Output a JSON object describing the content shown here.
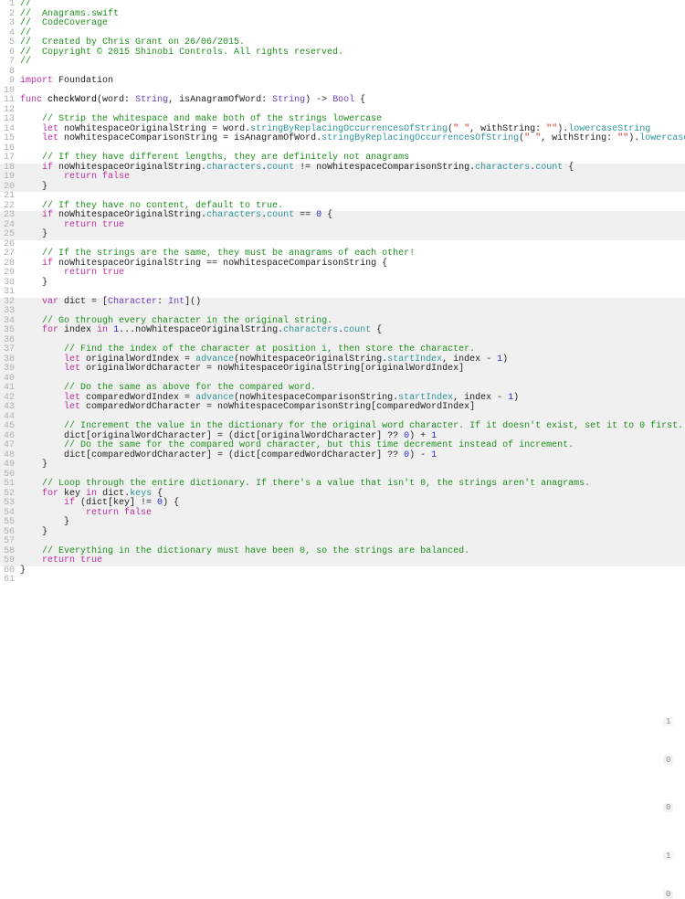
{
  "markers": [
    {
      "line": 14,
      "text": "1"
    },
    {
      "line": 18,
      "text": "0"
    },
    {
      "line": 23,
      "text": "0"
    },
    {
      "line": 28,
      "text": "1"
    },
    {
      "line": 32,
      "text": "0"
    }
  ],
  "lines": [
    {
      "n": 1,
      "hl": false,
      "spans": [
        [
          "comment",
          "//"
        ]
      ]
    },
    {
      "n": 2,
      "hl": false,
      "spans": [
        [
          "comment",
          "//  Anagrams.swift"
        ]
      ]
    },
    {
      "n": 3,
      "hl": false,
      "spans": [
        [
          "comment",
          "//  CodeCoverage"
        ]
      ]
    },
    {
      "n": 4,
      "hl": false,
      "spans": [
        [
          "comment",
          "//"
        ]
      ]
    },
    {
      "n": 5,
      "hl": false,
      "spans": [
        [
          "comment",
          "//  Created by Chris Grant on 26/06/2015."
        ]
      ]
    },
    {
      "n": 6,
      "hl": false,
      "spans": [
        [
          "comment",
          "//  Copyright © 2015 Shinobi Controls. All rights reserved."
        ]
      ]
    },
    {
      "n": 7,
      "hl": false,
      "spans": [
        [
          "comment",
          "//"
        ]
      ]
    },
    {
      "n": 8,
      "hl": false,
      "spans": [
        [
          "plain",
          ""
        ]
      ]
    },
    {
      "n": 9,
      "hl": false,
      "spans": [
        [
          "keyword",
          "import"
        ],
        [
          "plain",
          " Foundation"
        ]
      ]
    },
    {
      "n": 10,
      "hl": false,
      "spans": [
        [
          "plain",
          ""
        ]
      ]
    },
    {
      "n": 11,
      "hl": false,
      "spans": [
        [
          "keyword",
          "func"
        ],
        [
          "plain",
          " "
        ],
        [
          "black",
          "checkWord"
        ],
        [
          "plain",
          "(word: "
        ],
        [
          "type",
          "String"
        ],
        [
          "plain",
          ", isAnagramOfWord: "
        ],
        [
          "type",
          "String"
        ],
        [
          "plain",
          ") -> "
        ],
        [
          "type",
          "Bool"
        ],
        [
          "plain",
          " {"
        ]
      ]
    },
    {
      "n": 12,
      "hl": false,
      "spans": [
        [
          "plain",
          ""
        ]
      ]
    },
    {
      "n": 13,
      "hl": false,
      "spans": [
        [
          "plain",
          "    "
        ],
        [
          "comment",
          "// Strip the whitespace and make both of the strings lowercase"
        ]
      ]
    },
    {
      "n": 14,
      "hl": false,
      "spans": [
        [
          "plain",
          "    "
        ],
        [
          "keyword",
          "let"
        ],
        [
          "plain",
          " noWhitespaceOriginalString = word."
        ],
        [
          "func",
          "stringByReplacingOccurrencesOfString"
        ],
        [
          "plain",
          "("
        ],
        [
          "str",
          "\" \""
        ],
        [
          "plain",
          ", withString: "
        ],
        [
          "str",
          "\"\""
        ],
        [
          "plain",
          ")."
        ],
        [
          "ident",
          "lowercaseString"
        ]
      ]
    },
    {
      "n": 15,
      "hl": false,
      "spans": [
        [
          "plain",
          "    "
        ],
        [
          "keyword",
          "let"
        ],
        [
          "plain",
          " noWhitespaceComparisonString = isAnagramOfWord."
        ],
        [
          "func",
          "stringByReplacingOccurrencesOfString"
        ],
        [
          "plain",
          "("
        ],
        [
          "str",
          "\" \""
        ],
        [
          "plain",
          ", withString: "
        ],
        [
          "str",
          "\"\""
        ],
        [
          "plain",
          ")."
        ],
        [
          "ident",
          "lowercaseString"
        ]
      ]
    },
    {
      "n": 16,
      "hl": false,
      "spans": [
        [
          "plain",
          ""
        ]
      ]
    },
    {
      "n": 17,
      "hl": false,
      "spans": [
        [
          "plain",
          "    "
        ],
        [
          "comment",
          "// If they have different lengths, they are definitely not anagrams"
        ]
      ]
    },
    {
      "n": 18,
      "hl": true,
      "spans": [
        [
          "plain",
          "    "
        ],
        [
          "keyword",
          "if"
        ],
        [
          "plain",
          " noWhitespaceOriginalString."
        ],
        [
          "ident",
          "characters"
        ],
        [
          "plain",
          "."
        ],
        [
          "ident",
          "count"
        ],
        [
          "plain",
          " != noWhitespaceComparisonString."
        ],
        [
          "ident",
          "characters"
        ],
        [
          "plain",
          "."
        ],
        [
          "ident",
          "count"
        ],
        [
          "plain",
          " {"
        ]
      ]
    },
    {
      "n": 19,
      "hl": true,
      "spans": [
        [
          "plain",
          "        "
        ],
        [
          "keyword",
          "return"
        ],
        [
          "plain",
          " "
        ],
        [
          "keyword",
          "false"
        ]
      ]
    },
    {
      "n": 20,
      "hl": true,
      "spans": [
        [
          "plain",
          "    }"
        ]
      ]
    },
    {
      "n": 21,
      "hl": false,
      "spans": [
        [
          "plain",
          ""
        ]
      ]
    },
    {
      "n": 22,
      "hl": false,
      "spans": [
        [
          "plain",
          "    "
        ],
        [
          "comment",
          "// If they have no content, default to true."
        ]
      ]
    },
    {
      "n": 23,
      "hl": true,
      "spans": [
        [
          "plain",
          "    "
        ],
        [
          "keyword",
          "if"
        ],
        [
          "plain",
          " noWhitespaceOriginalString."
        ],
        [
          "ident",
          "characters"
        ],
        [
          "plain",
          "."
        ],
        [
          "ident",
          "count"
        ],
        [
          "plain",
          " == "
        ],
        [
          "num",
          "0"
        ],
        [
          "plain",
          " {"
        ]
      ]
    },
    {
      "n": 24,
      "hl": true,
      "spans": [
        [
          "plain",
          "        "
        ],
        [
          "keyword",
          "return"
        ],
        [
          "plain",
          " "
        ],
        [
          "keyword",
          "true"
        ]
      ]
    },
    {
      "n": 25,
      "hl": true,
      "spans": [
        [
          "plain",
          "    }"
        ]
      ]
    },
    {
      "n": 26,
      "hl": false,
      "spans": [
        [
          "plain",
          ""
        ]
      ]
    },
    {
      "n": 27,
      "hl": false,
      "spans": [
        [
          "plain",
          "    "
        ],
        [
          "comment",
          "// If the strings are the same, they must be anagrams of each other!"
        ]
      ]
    },
    {
      "n": 28,
      "hl": false,
      "spans": [
        [
          "plain",
          "    "
        ],
        [
          "keyword",
          "if"
        ],
        [
          "plain",
          " noWhitespaceOriginalString == noWhitespaceComparisonString {"
        ]
      ]
    },
    {
      "n": 29,
      "hl": false,
      "spans": [
        [
          "plain",
          "        "
        ],
        [
          "keyword",
          "return"
        ],
        [
          "plain",
          " "
        ],
        [
          "keyword",
          "true"
        ]
      ]
    },
    {
      "n": 30,
      "hl": false,
      "spans": [
        [
          "plain",
          "    }"
        ]
      ]
    },
    {
      "n": 31,
      "hl": false,
      "spans": [
        [
          "plain",
          ""
        ]
      ]
    },
    {
      "n": 32,
      "hl": true,
      "spans": [
        [
          "plain",
          "    "
        ],
        [
          "keyword",
          "var"
        ],
        [
          "plain",
          " dict = ["
        ],
        [
          "type",
          "Character"
        ],
        [
          "plain",
          ": "
        ],
        [
          "type",
          "Int"
        ],
        [
          "plain",
          "]()"
        ]
      ]
    },
    {
      "n": 33,
      "hl": true,
      "spans": [
        [
          "plain",
          ""
        ]
      ]
    },
    {
      "n": 34,
      "hl": true,
      "spans": [
        [
          "plain",
          "    "
        ],
        [
          "comment",
          "// Go through every character in the original string."
        ]
      ]
    },
    {
      "n": 35,
      "hl": true,
      "spans": [
        [
          "plain",
          "    "
        ],
        [
          "keyword",
          "for"
        ],
        [
          "plain",
          " index "
        ],
        [
          "keyword",
          "in"
        ],
        [
          "plain",
          " "
        ],
        [
          "num",
          "1"
        ],
        [
          "plain",
          "...noWhitespaceOriginalString."
        ],
        [
          "ident",
          "characters"
        ],
        [
          "plain",
          "."
        ],
        [
          "ident",
          "count"
        ],
        [
          "plain",
          " {"
        ]
      ]
    },
    {
      "n": 36,
      "hl": true,
      "spans": [
        [
          "plain",
          ""
        ]
      ]
    },
    {
      "n": 37,
      "hl": true,
      "spans": [
        [
          "plain",
          "        "
        ],
        [
          "comment",
          "// Find the index of the character at position i, then store the character."
        ]
      ]
    },
    {
      "n": 38,
      "hl": true,
      "spans": [
        [
          "plain",
          "        "
        ],
        [
          "keyword",
          "let"
        ],
        [
          "plain",
          " originalWordIndex = "
        ],
        [
          "func",
          "advance"
        ],
        [
          "plain",
          "(noWhitespaceOriginalString."
        ],
        [
          "ident",
          "startIndex"
        ],
        [
          "plain",
          ", index - "
        ],
        [
          "num",
          "1"
        ],
        [
          "plain",
          ")"
        ]
      ]
    },
    {
      "n": 39,
      "hl": true,
      "spans": [
        [
          "plain",
          "        "
        ],
        [
          "keyword",
          "let"
        ],
        [
          "plain",
          " originalWordCharacter = noWhitespaceOriginalString[originalWordIndex]"
        ]
      ]
    },
    {
      "n": 40,
      "hl": true,
      "spans": [
        [
          "plain",
          ""
        ]
      ]
    },
    {
      "n": 41,
      "hl": true,
      "spans": [
        [
          "plain",
          "        "
        ],
        [
          "comment",
          "// Do the same as above for the compared word."
        ]
      ]
    },
    {
      "n": 42,
      "hl": true,
      "spans": [
        [
          "plain",
          "        "
        ],
        [
          "keyword",
          "let"
        ],
        [
          "plain",
          " comparedWordIndex = "
        ],
        [
          "func",
          "advance"
        ],
        [
          "plain",
          "(noWhitespaceComparisonString."
        ],
        [
          "ident",
          "startIndex"
        ],
        [
          "plain",
          ", index - "
        ],
        [
          "num",
          "1"
        ],
        [
          "plain",
          ")"
        ]
      ]
    },
    {
      "n": 43,
      "hl": true,
      "spans": [
        [
          "plain",
          "        "
        ],
        [
          "keyword",
          "let"
        ],
        [
          "plain",
          " comparedWordCharacter = noWhitespaceComparisonString[comparedWordIndex]"
        ]
      ]
    },
    {
      "n": 44,
      "hl": true,
      "spans": [
        [
          "plain",
          ""
        ]
      ]
    },
    {
      "n": 45,
      "hl": true,
      "spans": [
        [
          "plain",
          "        "
        ],
        [
          "comment",
          "// Increment the value in the dictionary for the original word character. If it doesn't exist, set it to 0 first."
        ]
      ]
    },
    {
      "n": 46,
      "hl": true,
      "spans": [
        [
          "plain",
          "        dict[originalWordCharacter] = (dict[originalWordCharacter] ?? "
        ],
        [
          "num",
          "0"
        ],
        [
          "plain",
          ") + "
        ],
        [
          "num",
          "1"
        ]
      ]
    },
    {
      "n": 47,
      "hl": true,
      "spans": [
        [
          "plain",
          "        "
        ],
        [
          "comment",
          "// Do the same for the compared word character, but this time decrement instead of increment."
        ]
      ]
    },
    {
      "n": 48,
      "hl": true,
      "spans": [
        [
          "plain",
          "        dict[comparedWordCharacter] = (dict[comparedWordCharacter] ?? "
        ],
        [
          "num",
          "0"
        ],
        [
          "plain",
          ") - "
        ],
        [
          "num",
          "1"
        ]
      ]
    },
    {
      "n": 49,
      "hl": true,
      "spans": [
        [
          "plain",
          "    }"
        ]
      ]
    },
    {
      "n": 50,
      "hl": true,
      "spans": [
        [
          "plain",
          ""
        ]
      ]
    },
    {
      "n": 51,
      "hl": true,
      "spans": [
        [
          "plain",
          "    "
        ],
        [
          "comment",
          "// Loop through the entire dictionary. If there's a value that isn't 0, the strings aren't anagrams."
        ]
      ]
    },
    {
      "n": 52,
      "hl": true,
      "spans": [
        [
          "plain",
          "    "
        ],
        [
          "keyword",
          "for"
        ],
        [
          "plain",
          " key "
        ],
        [
          "keyword",
          "in"
        ],
        [
          "plain",
          " dict."
        ],
        [
          "ident",
          "keys"
        ],
        [
          "plain",
          " {"
        ]
      ]
    },
    {
      "n": 53,
      "hl": true,
      "spans": [
        [
          "plain",
          "        "
        ],
        [
          "keyword",
          "if"
        ],
        [
          "plain",
          " (dict[key] != "
        ],
        [
          "num",
          "0"
        ],
        [
          "plain",
          ") {"
        ]
      ]
    },
    {
      "n": 54,
      "hl": true,
      "spans": [
        [
          "plain",
          "            "
        ],
        [
          "keyword",
          "return"
        ],
        [
          "plain",
          " "
        ],
        [
          "keyword",
          "false"
        ]
      ]
    },
    {
      "n": 55,
      "hl": true,
      "spans": [
        [
          "plain",
          "        }"
        ]
      ]
    },
    {
      "n": 56,
      "hl": true,
      "spans": [
        [
          "plain",
          "    }"
        ]
      ]
    },
    {
      "n": 57,
      "hl": true,
      "spans": [
        [
          "plain",
          ""
        ]
      ]
    },
    {
      "n": 58,
      "hl": true,
      "spans": [
        [
          "plain",
          "    "
        ],
        [
          "comment",
          "// Everything in the dictionary must have been 0, so the strings are balanced."
        ]
      ]
    },
    {
      "n": 59,
      "hl": true,
      "spans": [
        [
          "plain",
          "    "
        ],
        [
          "keyword",
          "return"
        ],
        [
          "plain",
          " "
        ],
        [
          "keyword",
          "true"
        ]
      ]
    },
    {
      "n": 60,
      "hl": false,
      "spans": [
        [
          "plain",
          "}"
        ]
      ]
    },
    {
      "n": 61,
      "hl": false,
      "spans": [
        [
          "plain",
          ""
        ]
      ]
    }
  ]
}
